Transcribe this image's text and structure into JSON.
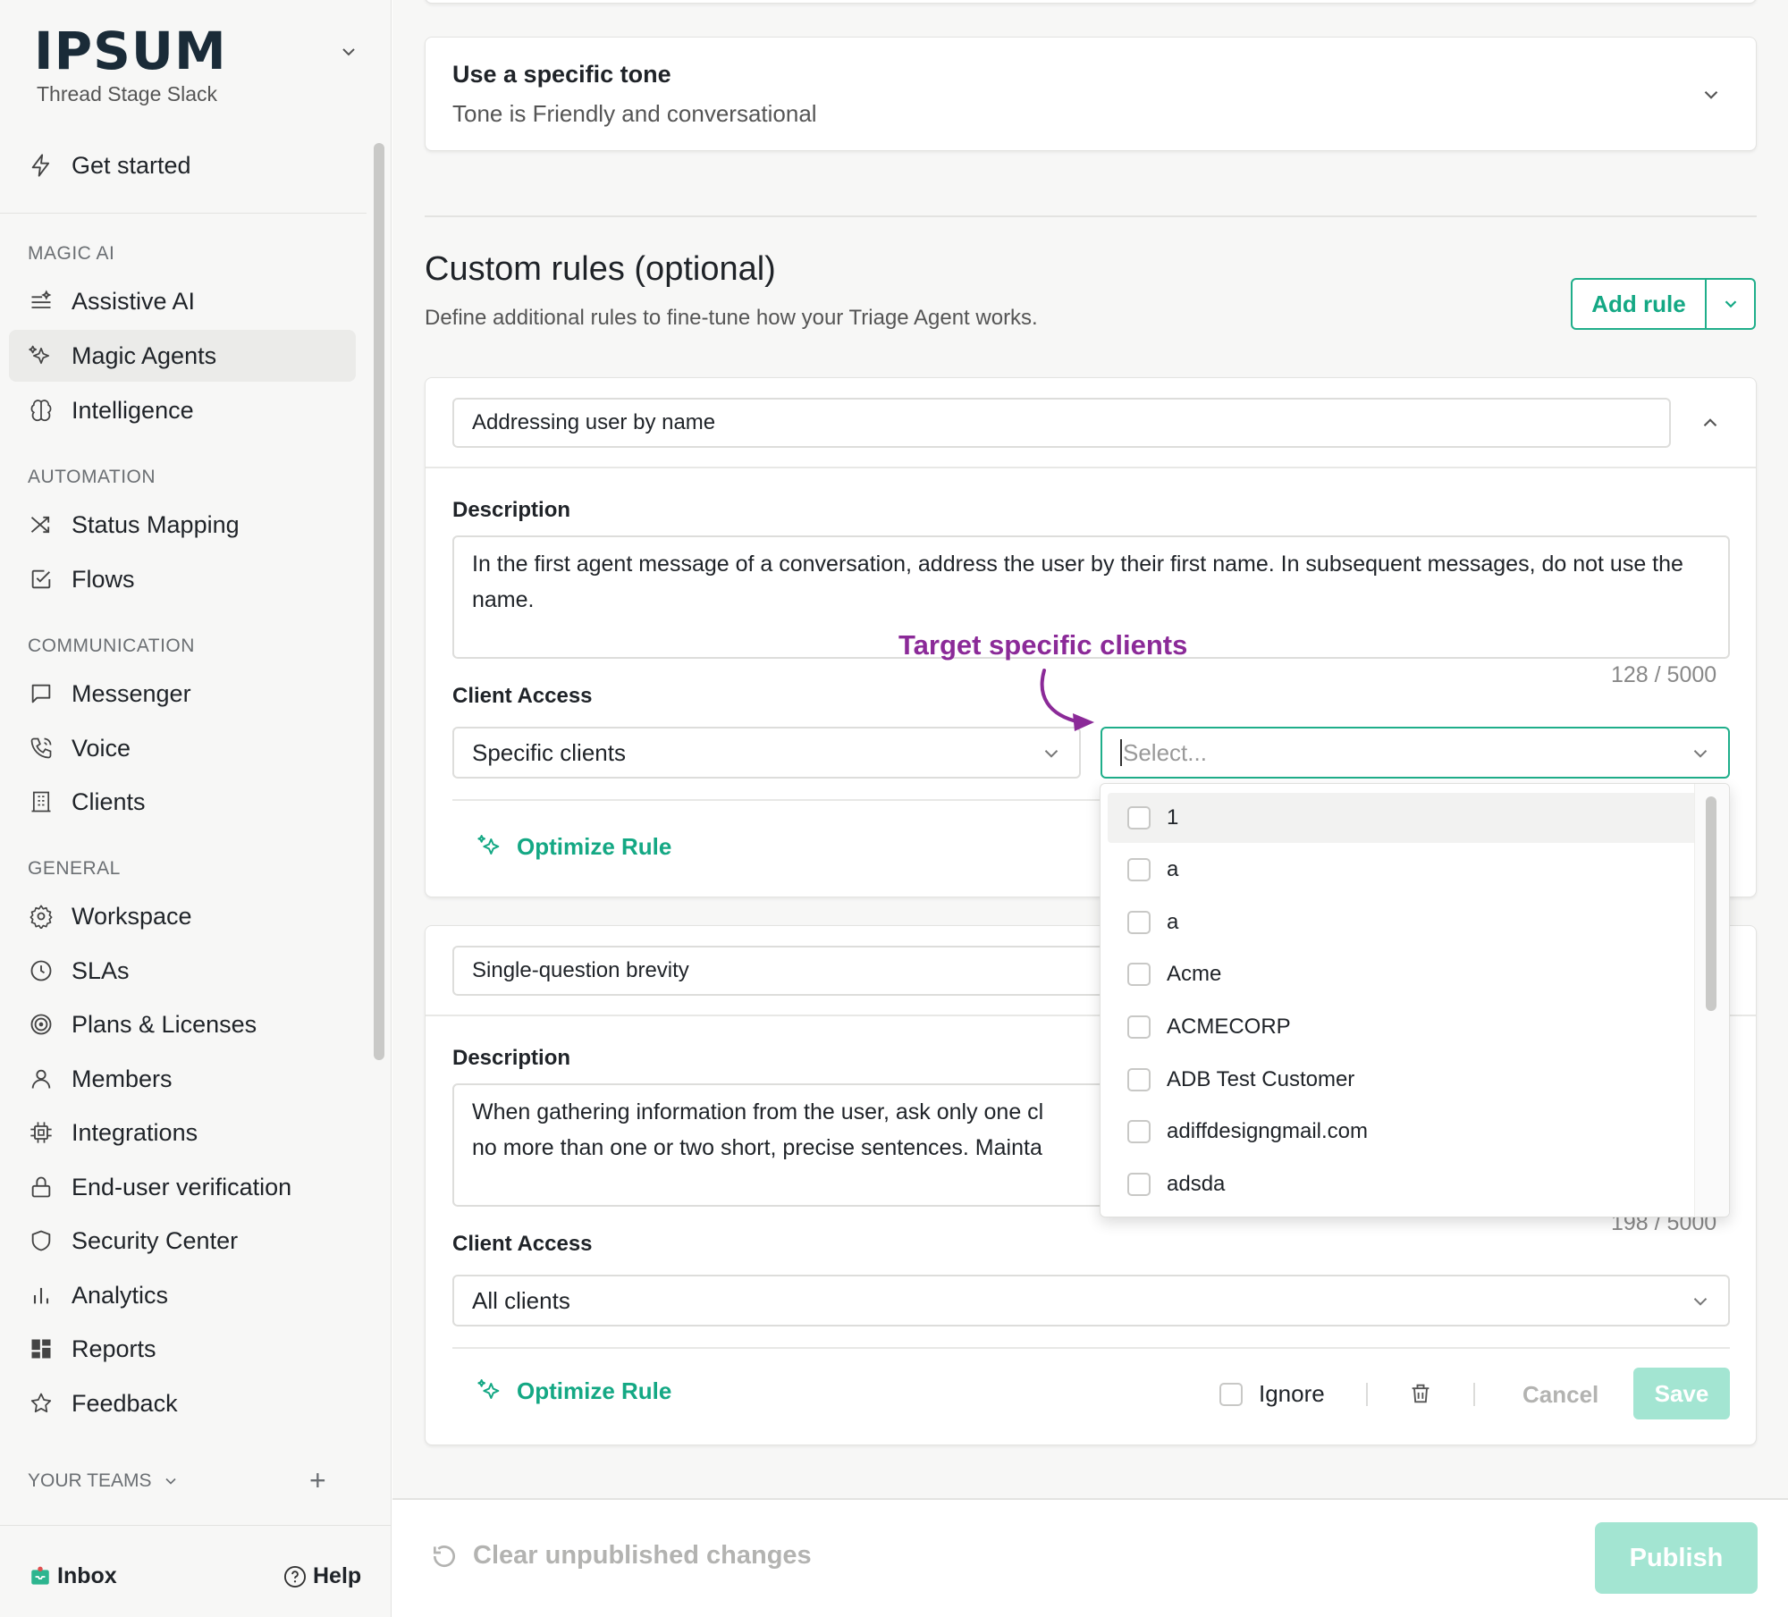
{
  "brand": {
    "logo": "IPSUM",
    "workspace": "Thread Stage Slack"
  },
  "sidebar": {
    "get_started": "Get started",
    "sections": {
      "magic_ai": "MAGIC AI",
      "automation": "AUTOMATION",
      "communication": "COMMUNICATION",
      "general": "GENERAL"
    },
    "items": {
      "assistive_ai": "Assistive AI",
      "magic_agents": "Magic Agents",
      "intelligence": "Intelligence",
      "status_mapping": "Status Mapping",
      "flows": "Flows",
      "messenger": "Messenger",
      "voice": "Voice",
      "clients": "Clients",
      "workspace": "Workspace",
      "slas": "SLAs",
      "plans": "Plans & Licenses",
      "members": "Members",
      "integrations": "Integrations",
      "end_user_verification": "End-user verification",
      "security_center": "Security Center",
      "analytics": "Analytics",
      "reports": "Reports",
      "feedback": "Feedback"
    },
    "active_item": "Magic Agents",
    "your_teams": "YOUR TEAMS",
    "footer": {
      "inbox": "Inbox",
      "help": "Help"
    }
  },
  "tone_card": {
    "title": "Use a specific tone",
    "subtitle": "Tone is Friendly and conversational"
  },
  "custom_rules": {
    "title": "Custom rules (optional)",
    "description": "Define additional rules to fine-tune how your Triage Agent works.",
    "add_rule_label": "Add rule"
  },
  "rule1": {
    "name": "Addressing user by name",
    "description_label": "Description",
    "description": "In the first agent message of a conversation, address the user by their first name. In subsequent messages, do not use the name.",
    "counter": "128 / 5000",
    "client_access_label": "Client Access",
    "client_access_value": "Specific clients",
    "client_select_placeholder": "Select...",
    "optimize_label": "Optimize Rule"
  },
  "rule2": {
    "name": "Single-question brevity",
    "description_label": "Description",
    "description_line1": "When gathering information from the user, ask only one cl",
    "description_line2": "no more than one or two short, precise sentences. Mainta",
    "counter": "198 / 5000",
    "client_access_label": "Client Access",
    "client_access_value": "All clients",
    "optimize_label": "Optimize Rule",
    "ignore_label": "Ignore",
    "cancel_label": "Cancel",
    "save_label": "Save"
  },
  "annotation": "Target specific clients",
  "dropdown_options": [
    "1",
    "a",
    "a",
    "Acme",
    "ACMECORP",
    "ADB Test Customer",
    "adiffdesigngmail.com",
    "adsda"
  ],
  "footer": {
    "clear_label": "Clear unpublished changes",
    "publish_label": "Publish"
  },
  "colors": {
    "accent": "#14a884",
    "accent_disabled": "#a3e5d2",
    "annotation": "#8b2a98"
  }
}
